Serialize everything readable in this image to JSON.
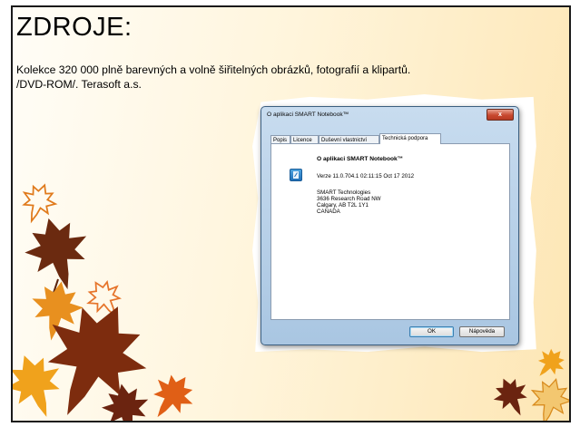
{
  "slide": {
    "title": "ZDROJE:",
    "text_line1": "Kolekce 320 000 plně barevných a volně šiřitelných obrázků, fotografií a klipartů.",
    "text_line2": "/DVD-ROM/. Terasoft a.s."
  },
  "dialog": {
    "title": "O aplikaci SMART Notebook™",
    "close_label": "x",
    "tabs": [
      {
        "label": "Popis"
      },
      {
        "label": "Licence"
      },
      {
        "label": "Duševní vlastnictví"
      },
      {
        "label": "Technická podpora"
      }
    ],
    "active_tab": "Technická podpora",
    "about_title": "O aplikaci SMART Notebook™",
    "version": "Verze 11.0.704.1 02:11:15 Oct 17 2012",
    "address": [
      "SMART Technologies",
      "3636 Research Road NW",
      "Calgary, AB T2L 1Y1",
      "CANADA"
    ],
    "ok_label": "OK",
    "help_label": "Nápověda"
  },
  "colors": {
    "background_light": "#fff5dc",
    "background_warm": "#fde6b4",
    "leaf_orange": "#e8871e",
    "leaf_dark": "#7a2a0e",
    "dialog_frame": "#a9c6e2",
    "close_red": "#c8482f"
  },
  "icons": [
    "autumn-leaf-icon",
    "smart-notebook-icon",
    "close-icon"
  ]
}
